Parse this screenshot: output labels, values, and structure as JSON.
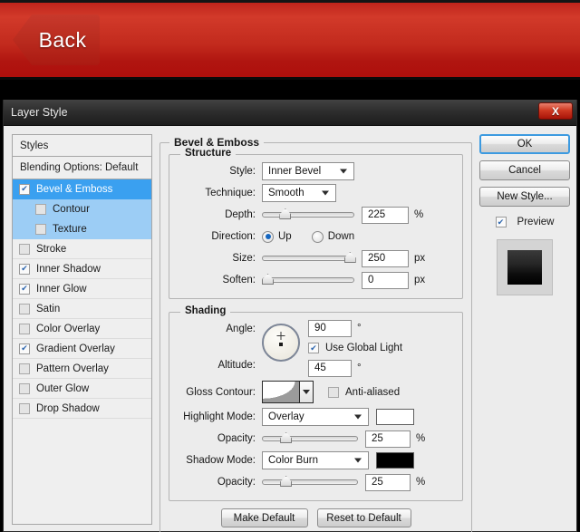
{
  "banner": {
    "back_label": "Back",
    "color": "#c22a1d"
  },
  "window": {
    "title": "Layer Style",
    "close_label": "X"
  },
  "sidebar": {
    "header": "Styles",
    "blending_options": "Blending Options: Default",
    "items": [
      {
        "label": "Bevel & Emboss",
        "checked": true,
        "selected": true,
        "sub": false
      },
      {
        "label": "Contour",
        "checked": false,
        "selected": false,
        "sub": true
      },
      {
        "label": "Texture",
        "checked": false,
        "selected": false,
        "sub": true
      },
      {
        "label": "Stroke",
        "checked": false,
        "selected": false,
        "sub": false
      },
      {
        "label": "Inner Shadow",
        "checked": true,
        "selected": false,
        "sub": false
      },
      {
        "label": "Inner Glow",
        "checked": true,
        "selected": false,
        "sub": false
      },
      {
        "label": "Satin",
        "checked": false,
        "selected": false,
        "sub": false
      },
      {
        "label": "Color Overlay",
        "checked": false,
        "selected": false,
        "sub": false
      },
      {
        "label": "Gradient Overlay",
        "checked": true,
        "selected": false,
        "sub": false
      },
      {
        "label": "Pattern Overlay",
        "checked": false,
        "selected": false,
        "sub": false
      },
      {
        "label": "Outer Glow",
        "checked": false,
        "selected": false,
        "sub": false
      },
      {
        "label": "Drop Shadow",
        "checked": false,
        "selected": false,
        "sub": false
      }
    ]
  },
  "main": {
    "title": "Bevel & Emboss",
    "structure": {
      "legend": "Structure",
      "style_label": "Style:",
      "style_value": "Inner Bevel",
      "technique_label": "Technique:",
      "technique_value": "Smooth",
      "depth_label": "Depth:",
      "depth_value": "225",
      "depth_unit": "%",
      "direction_label": "Direction:",
      "direction_up": "Up",
      "direction_down": "Down",
      "direction_selected": "Up",
      "size_label": "Size:",
      "size_value": "250",
      "size_unit": "px",
      "soften_label": "Soften:",
      "soften_value": "0",
      "soften_unit": "px"
    },
    "shading": {
      "legend": "Shading",
      "angle_label": "Angle:",
      "angle_value": "90",
      "angle_unit": "°",
      "global_light_label": "Use Global Light",
      "global_light_checked": true,
      "altitude_label": "Altitude:",
      "altitude_value": "45",
      "altitude_unit": "°",
      "gloss_contour_label": "Gloss Contour:",
      "anti_aliased_label": "Anti-aliased",
      "anti_aliased_checked": false,
      "highlight_mode_label": "Highlight Mode:",
      "highlight_mode_value": "Overlay",
      "highlight_color": "#ffffff",
      "highlight_opacity_label": "Opacity:",
      "highlight_opacity_value": "25",
      "highlight_opacity_unit": "%",
      "shadow_mode_label": "Shadow Mode:",
      "shadow_mode_value": "Color Burn",
      "shadow_color": "#000000",
      "shadow_opacity_label": "Opacity:",
      "shadow_opacity_value": "25",
      "shadow_opacity_unit": "%"
    },
    "make_default": "Make Default",
    "reset_to_default": "Reset to Default"
  },
  "actions": {
    "ok": "OK",
    "cancel": "Cancel",
    "new_style": "New Style...",
    "preview": "Preview",
    "preview_checked": true
  }
}
